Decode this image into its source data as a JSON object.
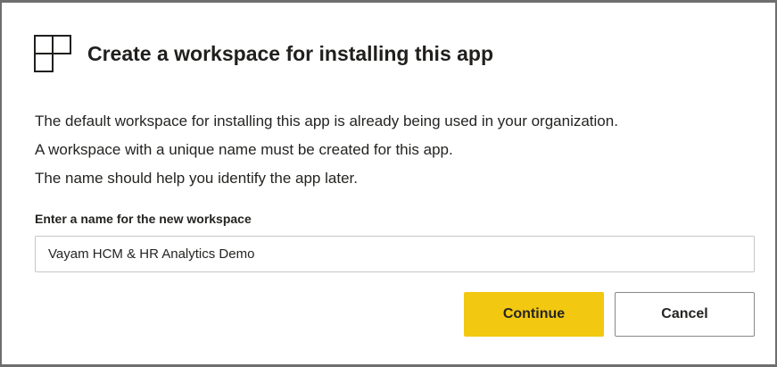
{
  "dialog": {
    "icon": "workspace-icon",
    "title": "Create a workspace for installing this app",
    "description": [
      "The default workspace for installing this app is already being used in your organization.",
      "A workspace with a unique name must be created for this app.",
      "The name should help you identify the app later."
    ],
    "field_label": "Enter a name for the new workspace",
    "field_value": "Vayam HCM & HR Analytics Demo",
    "continue_label": "Continue",
    "cancel_label": "Cancel"
  },
  "colors": {
    "primary": "#f2c811",
    "border": "#6e6e6e",
    "text": "#252423"
  }
}
